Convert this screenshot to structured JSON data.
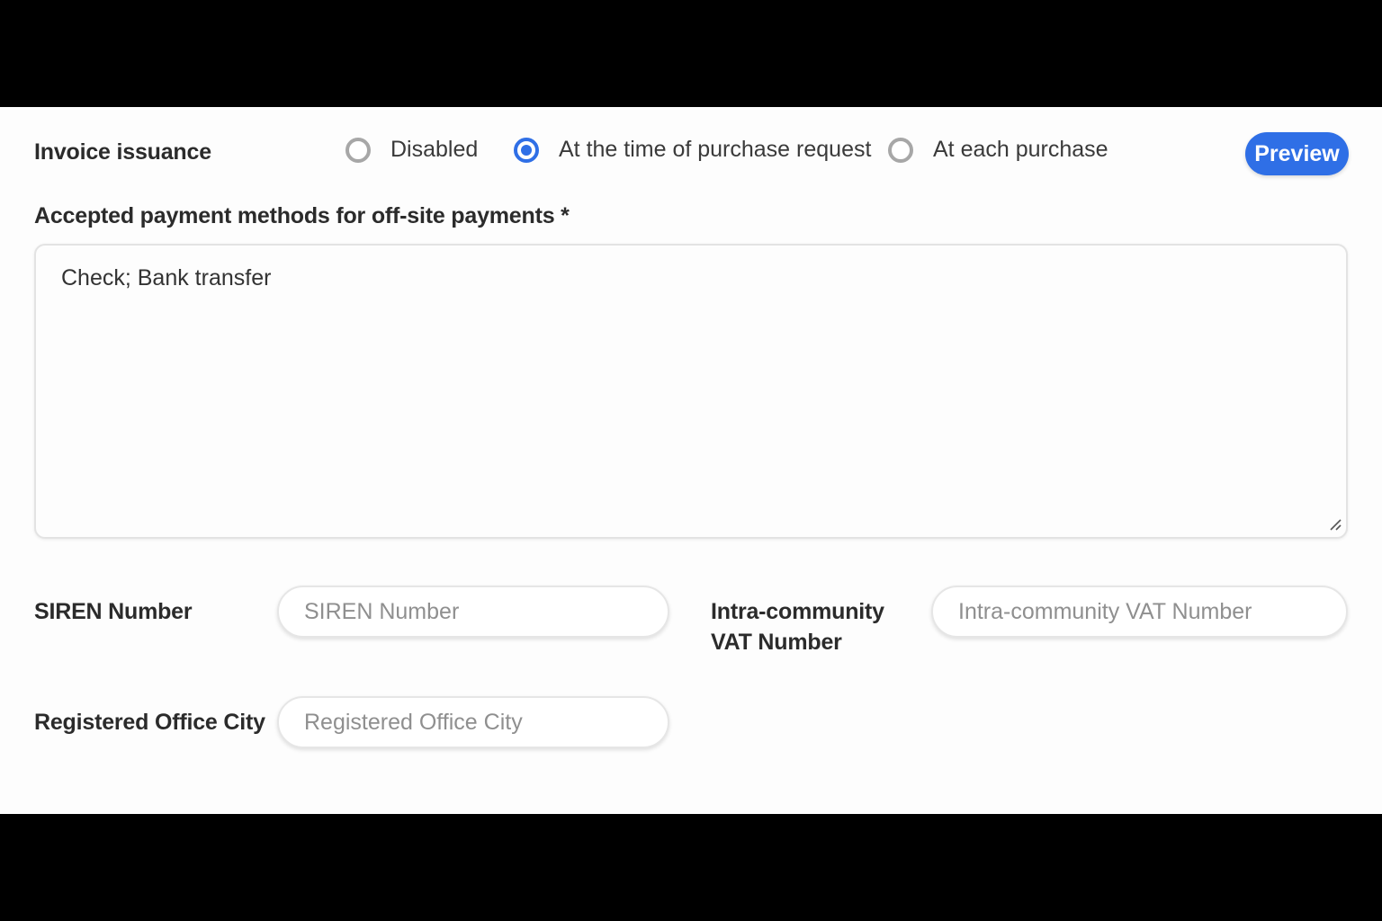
{
  "invoice": {
    "label": "Invoice issuance",
    "options": [
      {
        "label": "Disabled",
        "checked": false
      },
      {
        "label": "At the time of purchase request",
        "checked": true
      },
      {
        "label": "At each purchase",
        "checked": false
      }
    ],
    "preview_label": "Preview"
  },
  "payment_methods": {
    "label": "Accepted payment methods for off-site payments *",
    "value": "Check; Bank transfer"
  },
  "siren": {
    "label": "SIREN Number",
    "placeholder": "SIREN Number",
    "value": ""
  },
  "vat": {
    "label_line1": "Intra-community",
    "label_line2": "VAT Number",
    "placeholder": "Intra-community VAT Number",
    "value": ""
  },
  "city": {
    "label": "Registered Office City",
    "placeholder": "Registered Office City",
    "value": ""
  },
  "colors": {
    "accent": "#2f6fe6",
    "background": "#fdfdfd",
    "letterbox": "#000000"
  }
}
